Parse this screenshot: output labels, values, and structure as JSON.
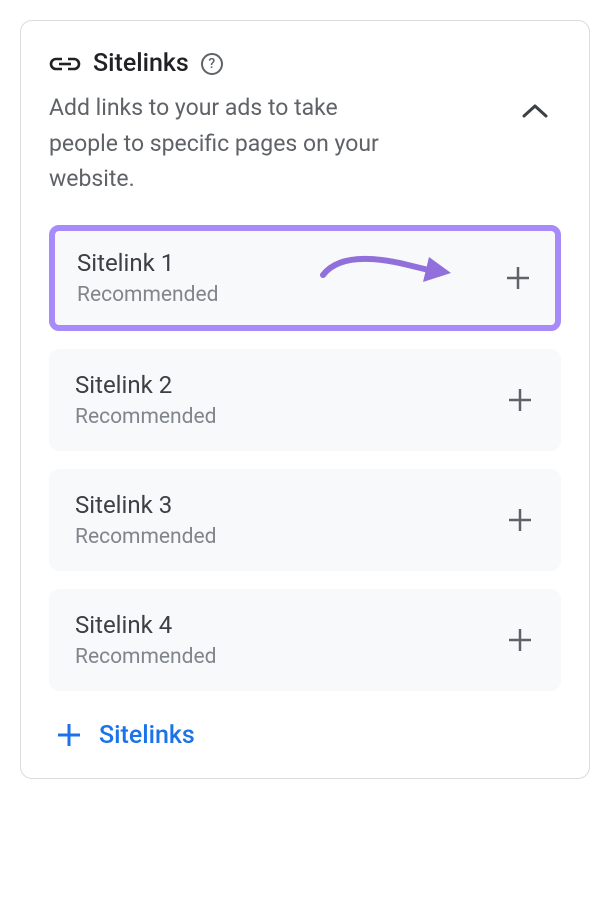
{
  "header": {
    "title": "Sitelinks",
    "description": "Add links to your ads to take people to specific pages on your website."
  },
  "items": [
    {
      "title": "Sitelink 1",
      "subtitle": "Recommended",
      "highlighted": true
    },
    {
      "title": "Sitelink 2",
      "subtitle": "Recommended",
      "highlighted": false
    },
    {
      "title": "Sitelink 3",
      "subtitle": "Recommended",
      "highlighted": false
    },
    {
      "title": "Sitelink 4",
      "subtitle": "Recommended",
      "highlighted": false
    }
  ],
  "add": {
    "label": "Sitelinks"
  },
  "colors": {
    "highlight": "#a78bfa",
    "primary": "#1a73e8",
    "textPrimary": "#202124",
    "textSecondary": "#5f6368"
  }
}
